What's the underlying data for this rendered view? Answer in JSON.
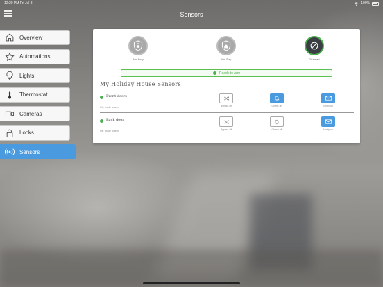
{
  "status_bar": {
    "time": "12:20 PM",
    "date": "Fri Jul 3",
    "battery": "100%"
  },
  "header": {
    "title": "Sensors"
  },
  "sidebar": {
    "items": [
      {
        "label": "Overview",
        "icon": "home-icon",
        "active": false
      },
      {
        "label": "Automations",
        "icon": "star-icon",
        "active": false
      },
      {
        "label": "Lights",
        "icon": "bulb-icon",
        "active": false
      },
      {
        "label": "Thermostat",
        "icon": "thermometer-icon",
        "active": false
      },
      {
        "label": "Cameras",
        "icon": "camera-icon",
        "active": false
      },
      {
        "label": "Locks",
        "icon": "lock-icon",
        "active": false
      },
      {
        "label": "Sensors",
        "icon": "broadcast-icon",
        "active": true
      }
    ]
  },
  "panel": {
    "modes": [
      {
        "label": "Arm Away",
        "icon": "shield-lock-icon",
        "selected": false
      },
      {
        "label": "Arm Stay",
        "icon": "shield-home-icon",
        "selected": false
      },
      {
        "label": "Disarmed",
        "icon": "disarmed-icon",
        "selected": true
      }
    ],
    "ready_text": "Ready to Arm",
    "section_title": "My Holiday House Sensors",
    "sensors": [
      {
        "name": "Front doors",
        "status": "OK, ready to arm",
        "actions": [
          {
            "label": "Bypass off",
            "icon": "shuffle-icon",
            "active": false
          },
          {
            "label": "Chime on",
            "icon": "bell-icon",
            "active": true
          },
          {
            "label": "Notify on",
            "icon": "mail-icon",
            "active": true
          }
        ]
      },
      {
        "name": "Back door",
        "status": "OK, ready to arm",
        "actions": [
          {
            "label": "Bypass off",
            "icon": "shuffle-icon",
            "active": false
          },
          {
            "label": "Chime off",
            "icon": "bell-icon",
            "active": false
          },
          {
            "label": "Notify on",
            "icon": "mail-icon",
            "active": true
          }
        ]
      }
    ]
  },
  "colors": {
    "accent": "#4a9ae0",
    "ready_green": "#4caf50"
  }
}
